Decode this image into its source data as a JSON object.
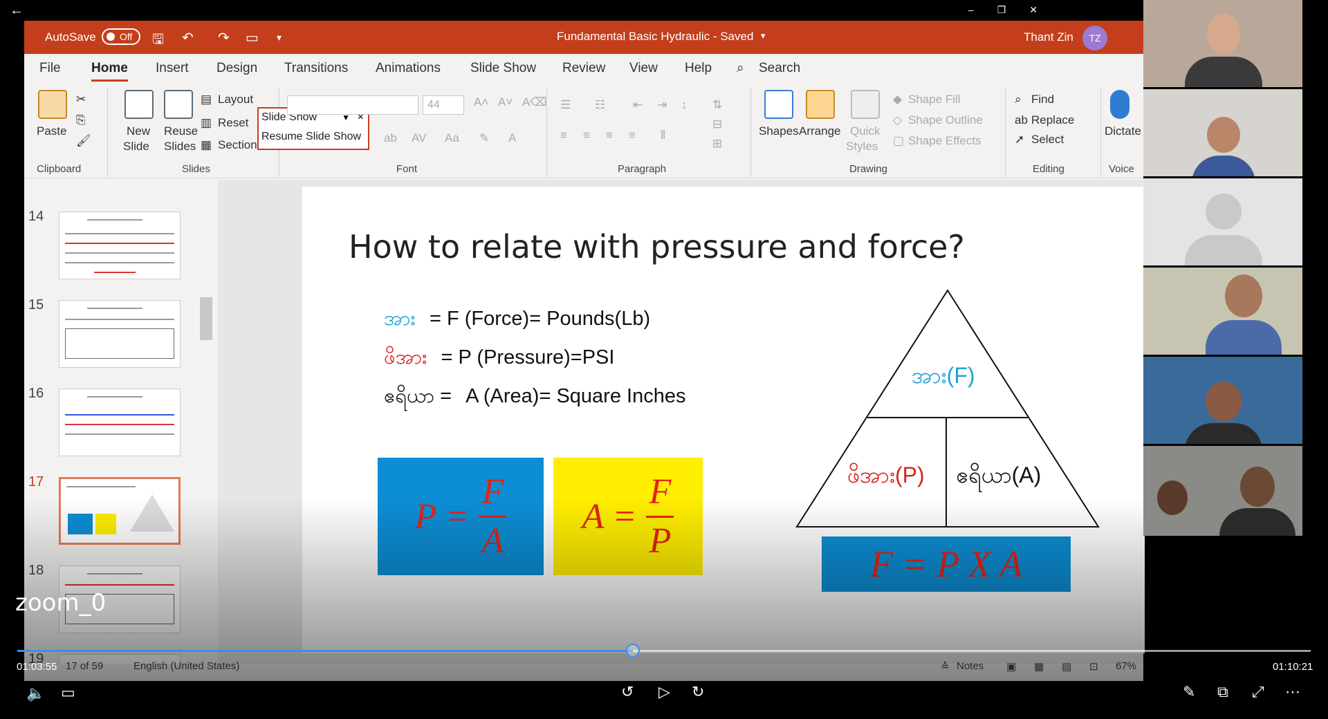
{
  "titlebar": {
    "autosave_label": "AutoSave",
    "autosave_state": "Off",
    "doc_title": "Fundamental Basic Hydraulic  -  Saved",
    "user_name": "Thant Zin",
    "user_initials": "TZ"
  },
  "tabs": [
    "File",
    "Home",
    "Insert",
    "Design",
    "Transitions",
    "Animations",
    "Slide Show",
    "Review",
    "View",
    "Help"
  ],
  "search_label": "Search",
  "ribbon": {
    "clipboard": {
      "paste": "Paste",
      "label": "Clipboard"
    },
    "slides": {
      "new_slide_1": "New",
      "new_slide_2": "Slide",
      "reuse_1": "Reuse",
      "reuse_2": "Slides",
      "layout": "Layout",
      "reset": "Reset",
      "section": "Section",
      "label": "Slides"
    },
    "font": {
      "size": "44",
      "label": "Font"
    },
    "paragraph": {
      "label": "Paragraph"
    },
    "drawing": {
      "shapes": "Shapes",
      "arrange": "Arrange",
      "quick_1": "Quick",
      "quick_2": "Styles",
      "shape_fill": "Shape Fill",
      "shape_outline": "Shape Outline",
      "shape_effects": "Shape Effects",
      "label": "Drawing"
    },
    "editing": {
      "find": "Find",
      "replace": "Replace",
      "select": "Select",
      "label": "Editing"
    },
    "voice": {
      "dictate": "Dictate",
      "label": "Voice"
    }
  },
  "slideshow_popup": {
    "title": "Slide Show",
    "resume": "Resume Slide Show"
  },
  "thumbnails": [
    {
      "num": "14"
    },
    {
      "num": "15"
    },
    {
      "num": "16"
    },
    {
      "num": "17"
    },
    {
      "num": "18"
    },
    {
      "num": "19"
    }
  ],
  "slide": {
    "title": "How to relate with pressure and force?",
    "defs": [
      {
        "term": "အား",
        "rest": "= F (Force)= Pounds(Lb)"
      },
      {
        "term": "ဖိအား",
        "rest": "= P (Pressure)=PSI"
      },
      {
        "term": "ဧရိယာ =",
        "rest": "A (Area)= Square Inches"
      }
    ],
    "formula1": {
      "lhs": "P =",
      "num": "F",
      "den": "A"
    },
    "formula2": {
      "lhs": "A =",
      "num": "F",
      "den": "P"
    },
    "triangle": {
      "top": "အား(F)",
      "left": "ဖိအား(P)",
      "right": "ဧရိယာ(A)"
    },
    "fpxa": "F = P X A"
  },
  "status": {
    "slide_count": "17 of 59",
    "language": "English (United States)",
    "notes": "Notes",
    "zoom": "67%"
  },
  "player": {
    "current_time": "01:03:55",
    "total_time": "01:10:21",
    "progress": 0.476,
    "overlay_label": "zoom_0"
  },
  "colors": {
    "accent": "#c43e1c",
    "formula_blue": "#0d8ed4",
    "formula_yellow": "#ffee00",
    "formula_red": "#e0241a",
    "term_blue": "#1ea3d6"
  }
}
